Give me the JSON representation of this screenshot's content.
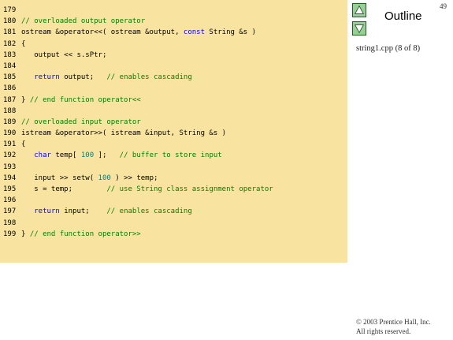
{
  "page_number": "49",
  "outline": {
    "title": "Outline",
    "caption": "string1.cpp (8 of 8)",
    "up_icon": "triangle-up-icon",
    "down_icon": "triangle-down-icon"
  },
  "copyright": {
    "line1": "© 2003 Prentice Hall, Inc.",
    "line2": "All rights reserved."
  },
  "colors": {
    "panel": "#f8e4a0",
    "comment": "#008000",
    "keyword": "#0000ff",
    "number": "#008080",
    "nav_button": "#9acd9a"
  },
  "code": [
    {
      "n": "179",
      "tokens": []
    },
    {
      "n": "180",
      "tokens": [
        {
          "t": "// overloaded output operator",
          "c": "c"
        }
      ]
    },
    {
      "n": "181",
      "tokens": [
        {
          "t": "ostream &operator<<( ostream &output, ",
          "c": ""
        },
        {
          "t": "const",
          "c": "k"
        },
        {
          "t": " String &s )",
          "c": ""
        }
      ]
    },
    {
      "n": "182",
      "tokens": [
        {
          "t": "{",
          "c": ""
        }
      ]
    },
    {
      "n": "183",
      "tokens": [
        {
          "t": "   output << s.sPtr;",
          "c": ""
        }
      ]
    },
    {
      "n": "184",
      "tokens": []
    },
    {
      "n": "185",
      "tokens": [
        {
          "t": "   ",
          "c": ""
        },
        {
          "t": "return",
          "c": "k"
        },
        {
          "t": " output;   ",
          "c": ""
        },
        {
          "t": "// enables cascading",
          "c": "c"
        }
      ]
    },
    {
      "n": "186",
      "tokens": []
    },
    {
      "n": "187",
      "tokens": [
        {
          "t": "} ",
          "c": ""
        },
        {
          "t": "// end function operator<<",
          "c": "c"
        }
      ]
    },
    {
      "n": "188",
      "tokens": []
    },
    {
      "n": "189",
      "tokens": [
        {
          "t": "// overloaded input operator",
          "c": "c"
        }
      ]
    },
    {
      "n": "190",
      "tokens": [
        {
          "t": "istream &operator>>( istream &input, String &s )",
          "c": ""
        }
      ]
    },
    {
      "n": "191",
      "tokens": [
        {
          "t": "{",
          "c": ""
        }
      ]
    },
    {
      "n": "192",
      "tokens": [
        {
          "t": "   ",
          "c": ""
        },
        {
          "t": "char",
          "c": "k"
        },
        {
          "t": " temp[ ",
          "c": ""
        },
        {
          "t": "100",
          "c": "n"
        },
        {
          "t": " ];   ",
          "c": ""
        },
        {
          "t": "// buffer to store input",
          "c": "c"
        }
      ]
    },
    {
      "n": "193",
      "tokens": []
    },
    {
      "n": "194",
      "tokens": [
        {
          "t": "   input >> setw( ",
          "c": ""
        },
        {
          "t": "100",
          "c": "n"
        },
        {
          "t": " ) >> temp;",
          "c": ""
        }
      ]
    },
    {
      "n": "195",
      "tokens": [
        {
          "t": "   s = temp;        ",
          "c": ""
        },
        {
          "t": "// use String class assignment operator",
          "c": "c"
        }
      ]
    },
    {
      "n": "196",
      "tokens": []
    },
    {
      "n": "197",
      "tokens": [
        {
          "t": "   ",
          "c": ""
        },
        {
          "t": "return",
          "c": "k"
        },
        {
          "t": " input;    ",
          "c": ""
        },
        {
          "t": "// enables cascading",
          "c": "c"
        }
      ]
    },
    {
      "n": "198",
      "tokens": []
    },
    {
      "n": "199",
      "tokens": [
        {
          "t": "} ",
          "c": ""
        },
        {
          "t": "// end function operator>>",
          "c": "c"
        }
      ]
    }
  ]
}
